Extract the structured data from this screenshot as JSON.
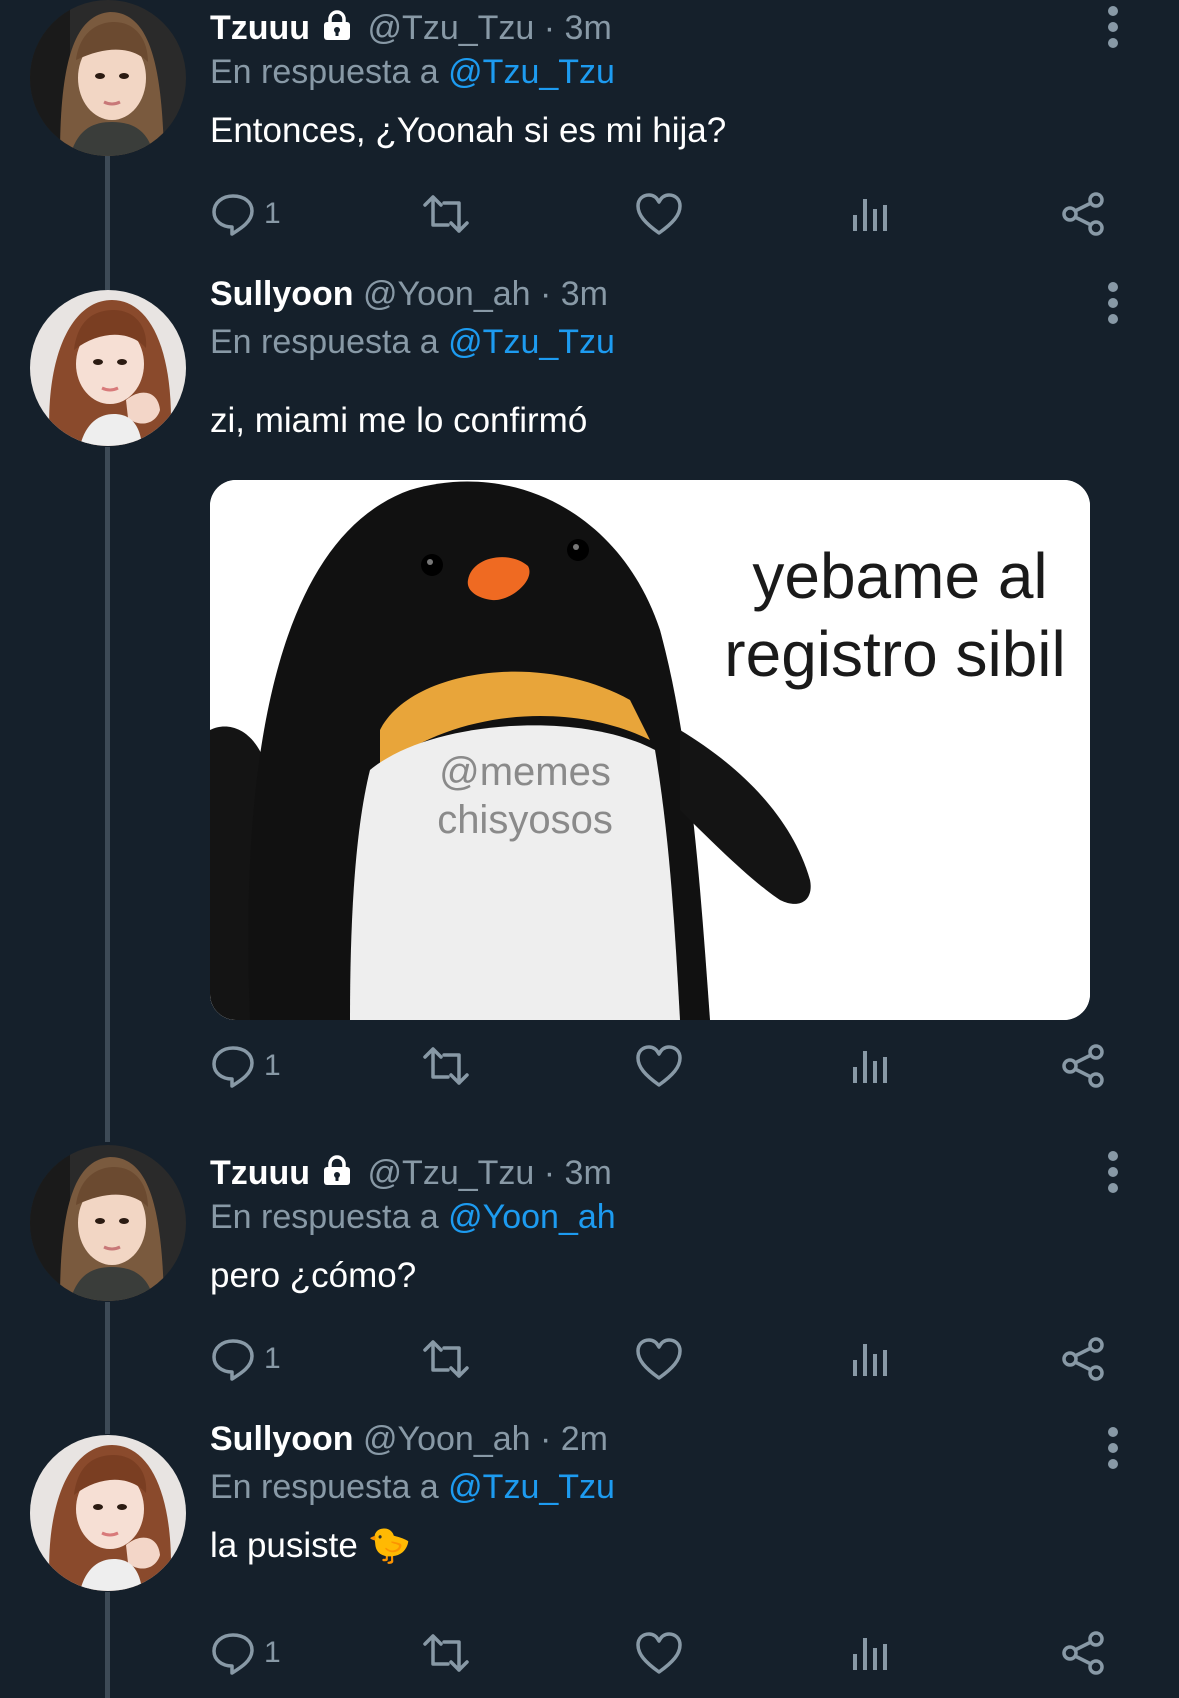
{
  "tweets": [
    {
      "name": "Tzuuu",
      "handle": "@Tzu_Tzu",
      "time": "· 3m",
      "protected": true,
      "reply_prefix": "En respuesta a",
      "reply_to": "@Tzu_Tzu",
      "text": "Entonces, ¿Yoonah si es mi hija?",
      "reply_count": "1"
    },
    {
      "name": "Sullyoon",
      "handle": "@Yoon_ah",
      "time": "· 3m",
      "protected": false,
      "reply_prefix": "En respuesta a",
      "reply_to": "@Tzu_Tzu",
      "text": "zi, miami me lo confirmó",
      "reply_count": "1",
      "media": {
        "line1": "yebame al",
        "line2": "registro sibil",
        "watermark1": "@memes",
        "watermark2": "chisyosos"
      }
    },
    {
      "name": "Tzuuu",
      "handle": "@Tzu_Tzu",
      "time": "· 3m",
      "protected": true,
      "reply_prefix": "En respuesta a",
      "reply_to": "@Yoon_ah",
      "text": "pero ¿cómo?",
      "reply_count": "1"
    },
    {
      "name": "Sullyoon",
      "handle": "@Yoon_ah",
      "time": "· 2m",
      "protected": false,
      "reply_prefix": "En respuesta a",
      "reply_to": "@Tzu_Tzu",
      "text": "la pusiste 🐤",
      "reply_count": "1"
    }
  ],
  "colors": {
    "background": "#15202b",
    "secondary_text": "#8899a6",
    "link": "#1d9bf0",
    "thread_line": "#3d4a56"
  }
}
